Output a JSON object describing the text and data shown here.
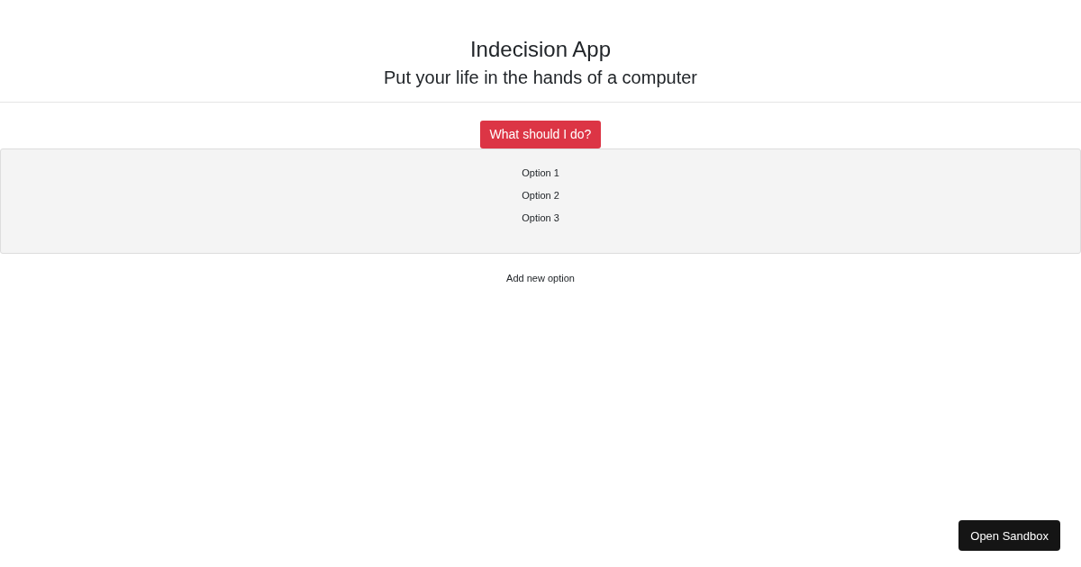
{
  "header": {
    "title": "Indecision App",
    "subtitle": "Put your life in the hands of a computer"
  },
  "action_button": "What should I do?",
  "options": [
    {
      "label": "Option 1"
    },
    {
      "label": "Option 2"
    },
    {
      "label": "Option 3"
    }
  ],
  "add_option_button": "Add new option",
  "sandbox_button": "Open Sandbox"
}
